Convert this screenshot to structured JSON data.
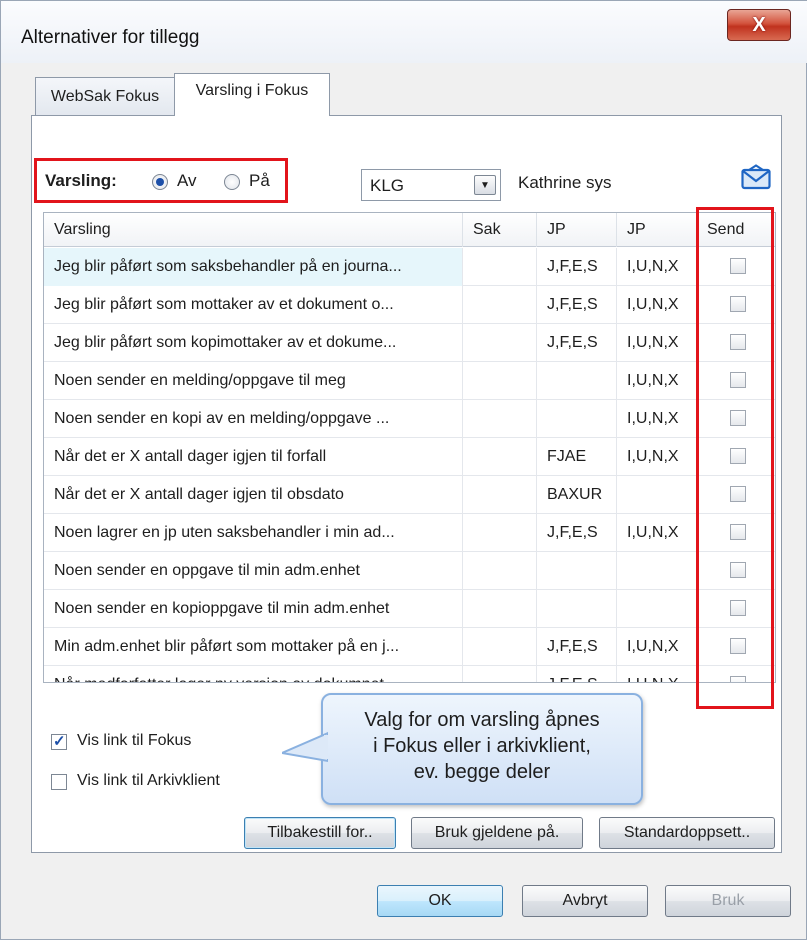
{
  "window": {
    "title": "Alternativer for tillegg",
    "close_glyph": "X"
  },
  "tabs": [
    {
      "label": "WebSak Fokus",
      "active": false
    },
    {
      "label": "Varsling i Fokus",
      "active": true
    }
  ],
  "varsling": {
    "label": "Varsling:",
    "options": [
      {
        "label": "Av",
        "selected": true
      },
      {
        "label": "På",
        "selected": false
      }
    ]
  },
  "user_select": {
    "value": "KLG",
    "arrow_icon": "chevron-down-icon"
  },
  "user_name": "Kathrine sys",
  "mail_icon": "envelope-icon",
  "grid": {
    "columns": [
      "Varsling",
      "Sak",
      "JP",
      "JP",
      "Send"
    ],
    "rows": [
      {
        "text": "Jeg blir påført som saksbehandler på en journa...",
        "sak": "",
        "jp1": "J,F,E,S",
        "jp2": "I,U,N,X",
        "send": false
      },
      {
        "text": "Jeg blir påført som mottaker av et dokument o...",
        "sak": "",
        "jp1": "J,F,E,S",
        "jp2": "I,U,N,X",
        "send": false
      },
      {
        "text": "Jeg blir påført som kopimottaker av et dokume...",
        "sak": "",
        "jp1": "J,F,E,S",
        "jp2": "I,U,N,X",
        "send": false
      },
      {
        "text": "Noen sender en melding/oppgave til meg",
        "sak": "",
        "jp1": "",
        "jp2": "I,U,N,X",
        "send": false
      },
      {
        "text": "Noen sender en kopi av en melding/oppgave ...",
        "sak": "",
        "jp1": "",
        "jp2": "I,U,N,X",
        "send": false
      },
      {
        "text": "Når det er X antall dager igjen til forfall",
        "sak": "",
        "jp1": "FJAE",
        "jp2": "I,U,N,X",
        "send": false
      },
      {
        "text": "Når det er X antall dager igjen til obsdato",
        "sak": "",
        "jp1": "BAXUR",
        "jp2": "",
        "send": false
      },
      {
        "text": "Noen lagrer en jp uten saksbehandler i min ad...",
        "sak": "",
        "jp1": "J,F,E,S",
        "jp2": "I,U,N,X",
        "send": false
      },
      {
        "text": "Noen sender en oppgave til min adm.enhet",
        "sak": "",
        "jp1": "",
        "jp2": "",
        "send": false
      },
      {
        "text": "Noen sender en kopioppgave til min adm.enhet",
        "sak": "",
        "jp1": "",
        "jp2": "",
        "send": false
      },
      {
        "text": "Min adm.enhet blir påført som mottaker på en j...",
        "sak": "",
        "jp1": "J,F,E,S",
        "jp2": "I,U,N,X",
        "send": false
      },
      {
        "text": "Når medforfatter lager ny versjon av dokumnet...",
        "sak": "",
        "jp1": "J,F,E,S",
        "jp2": "I,U,N,X",
        "send": false
      }
    ]
  },
  "links": [
    {
      "label": "Vis link til Fokus",
      "checked": true
    },
    {
      "label": "Vis link til Arkivklient",
      "checked": false
    }
  ],
  "callout": {
    "line1": "Valg for om varsling åpnes",
    "line2": "i Fokus eller i arkivklient,",
    "line3": "ev. begge deler"
  },
  "panel_buttons": {
    "reset": "Tilbakestill for..",
    "apply_to": "Bruk gjeldene på.",
    "defaults": "Standardoppsett.."
  },
  "dialog_buttons": {
    "ok": "OK",
    "cancel": "Avbryt",
    "apply": "Bruk"
  },
  "colors": {
    "highlight_red": "#e2141b",
    "selection": "#e6f6fb",
    "callout": "#cfe0f6"
  }
}
